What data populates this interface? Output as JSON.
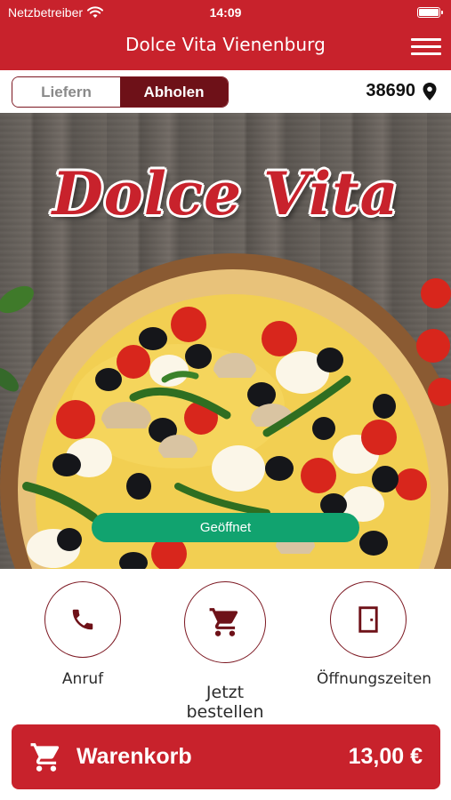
{
  "status_bar": {
    "carrier": "Netzbetreiber",
    "time": "14:09"
  },
  "header": {
    "title": "Dolce Vita Vienenburg"
  },
  "mode_toggle": {
    "delivery_label": "Liefern",
    "pickup_label": "Abholen",
    "selected": "Abholen"
  },
  "location": {
    "zip": "38690"
  },
  "hero": {
    "logo_text": "Dolce Vita",
    "status_badge": "Geöffnet"
  },
  "actions": [
    {
      "label": "Anruf",
      "icon": "phone-icon"
    },
    {
      "label": "Jetzt bestellen",
      "icon": "cart-icon"
    },
    {
      "label": "Öffnungszeiten",
      "icon": "door-icon"
    }
  ],
  "cart": {
    "label": "Warenkorb",
    "total": "13,00 €"
  },
  "colors": {
    "brand_red": "#c8222c",
    "dark_red": "#6e1118",
    "open_green": "#11a36f"
  }
}
